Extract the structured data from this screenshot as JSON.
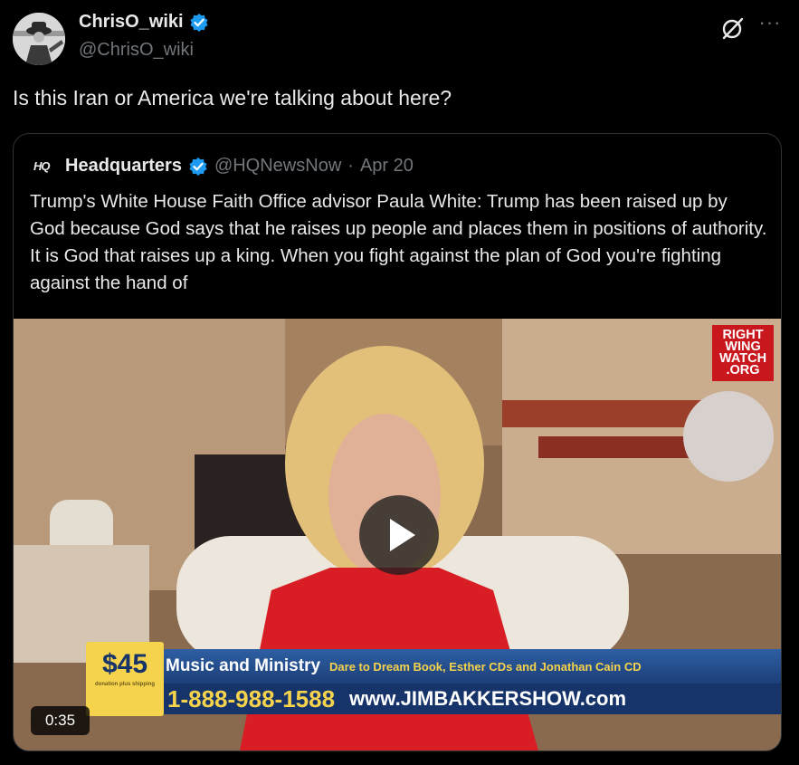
{
  "author": {
    "name": "ChrisO_wiki",
    "handle": "@ChrisO_wiki",
    "avatar_icon": "profile-photo-icon",
    "verified_color": "#1d9bf0"
  },
  "tweet": {
    "text": "Is this Iran or America we're talking about here?"
  },
  "actions": {
    "grok_icon": "grok-icon",
    "more_label": "···"
  },
  "quote": {
    "logo": "HQ",
    "name": "Headquarters",
    "handle": "@HQNewsNow",
    "separator": "·",
    "date": "Apr 20",
    "text": "Trump's White House Faith Office advisor Paula White: Trump has been raised up by God because God says that he raises up people and places them in positions of authority. It is God that raises up a king. When you fight against the plan of God you're fighting against the hand of",
    "video": {
      "duration": "0:35",
      "watermark": [
        "RIGHT",
        "WING",
        "WATCH",
        ".ORG"
      ],
      "price": "$45",
      "price_fine": "donation plus shipping",
      "banner_main": "Music and Ministry",
      "banner_sub": "Dare to Dream Book, Esther CDs and Jonathan Cain CD",
      "phone": "1-888-988-1588",
      "url": "www.JIMBAKKERSHOW.com"
    }
  }
}
